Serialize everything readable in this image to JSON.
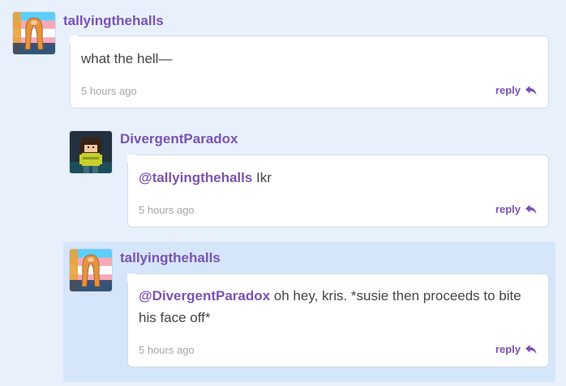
{
  "colors": {
    "page_background": "#e7f0fb",
    "highlight_background": "#d5e5fa",
    "accent": "#7a52b3",
    "body_text": "#444444",
    "muted_text": "#a6a6a6"
  },
  "comments": [
    {
      "username": "tallyingthehalls",
      "avatar": "trans-flag-avatar",
      "mention": "",
      "text": "what the hell—",
      "time": "5 hours ago",
      "reply_label": "reply",
      "highlighted": false
    },
    {
      "username": "DivergentParadox",
      "avatar": "kris-pixel-avatar",
      "mention": "@tallyingthehalls",
      "text": " Ikr",
      "time": "5 hours ago",
      "reply_label": "reply",
      "highlighted": false
    },
    {
      "username": "tallyingthehalls",
      "avatar": "trans-flag-avatar",
      "mention": "@DivergentParadox",
      "text": " oh hey, kris. *susie then proceeds to bite his face off*",
      "time": "5 hours ago",
      "reply_label": "reply",
      "highlighted": true
    }
  ]
}
